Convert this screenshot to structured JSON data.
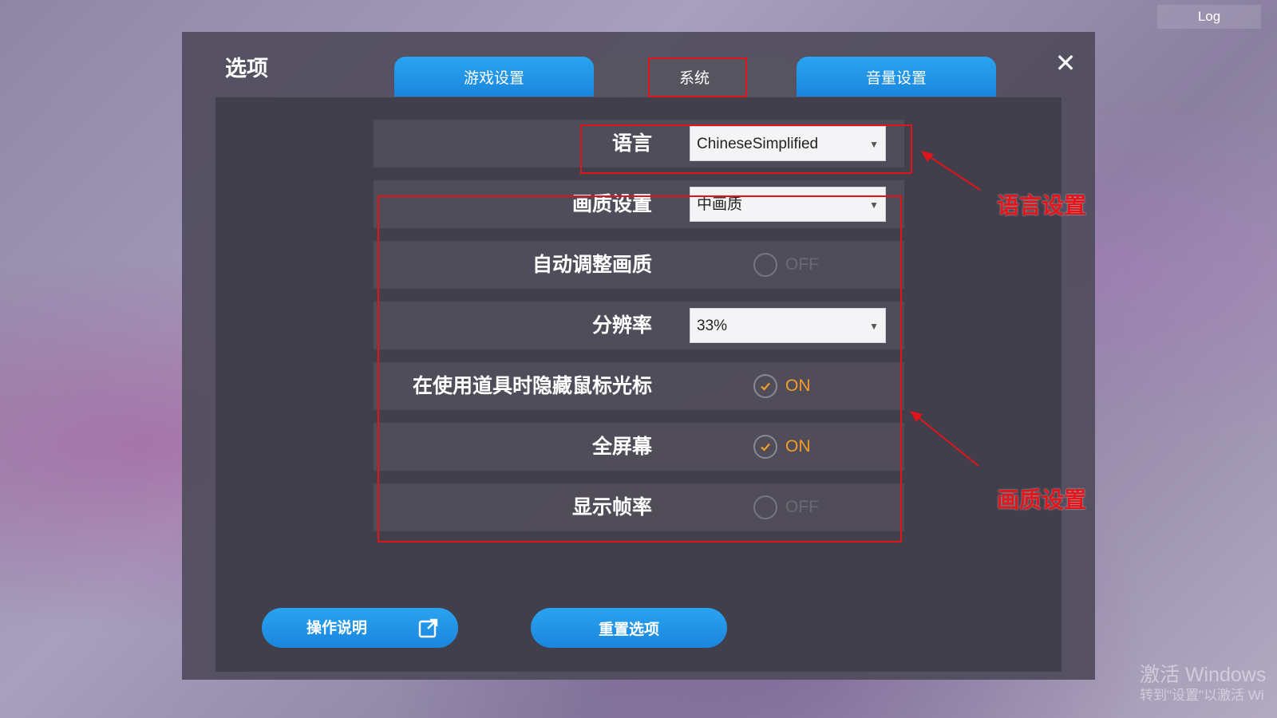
{
  "top_right": {
    "log_label": "Log"
  },
  "dialog": {
    "title": "选项",
    "close_symbol": "✕",
    "tabs": [
      {
        "label": "游戏设置",
        "state": "inactive"
      },
      {
        "label": "系统",
        "state": "active"
      },
      {
        "label": "音量设置",
        "state": "inactive"
      }
    ]
  },
  "settings": {
    "language": {
      "label": "语言",
      "value": "ChineseSimplified"
    },
    "quality": {
      "label": "画质设置",
      "value": "中画质"
    },
    "auto_quality": {
      "label": "自动调整画质",
      "state": "OFF"
    },
    "resolution": {
      "label": "分辨率",
      "value": "33%"
    },
    "hide_cursor": {
      "label": "在使用道具时隐藏鼠标光标",
      "state": "ON"
    },
    "fullscreen": {
      "label": "全屏幕",
      "state": "ON"
    },
    "show_fps": {
      "label": "显示帧率",
      "state": "OFF"
    }
  },
  "buttons": {
    "help_label": "操作说明",
    "reset_label": "重置选项"
  },
  "annotations": {
    "language_note": "语言设置",
    "quality_note": "画质设置"
  },
  "watermark": {
    "line1": "激活 Windows",
    "line2": "转到\"设置\"以激活 Wi"
  },
  "colors": {
    "tab_blue": "#1f93e6",
    "accent_orange": "#f39c2a",
    "highlight_red": "#e0141a"
  },
  "icons": {
    "close": "close-icon",
    "external_link": "external-link-icon",
    "check": "check-icon",
    "dropdown": "chevron-down-icon"
  }
}
